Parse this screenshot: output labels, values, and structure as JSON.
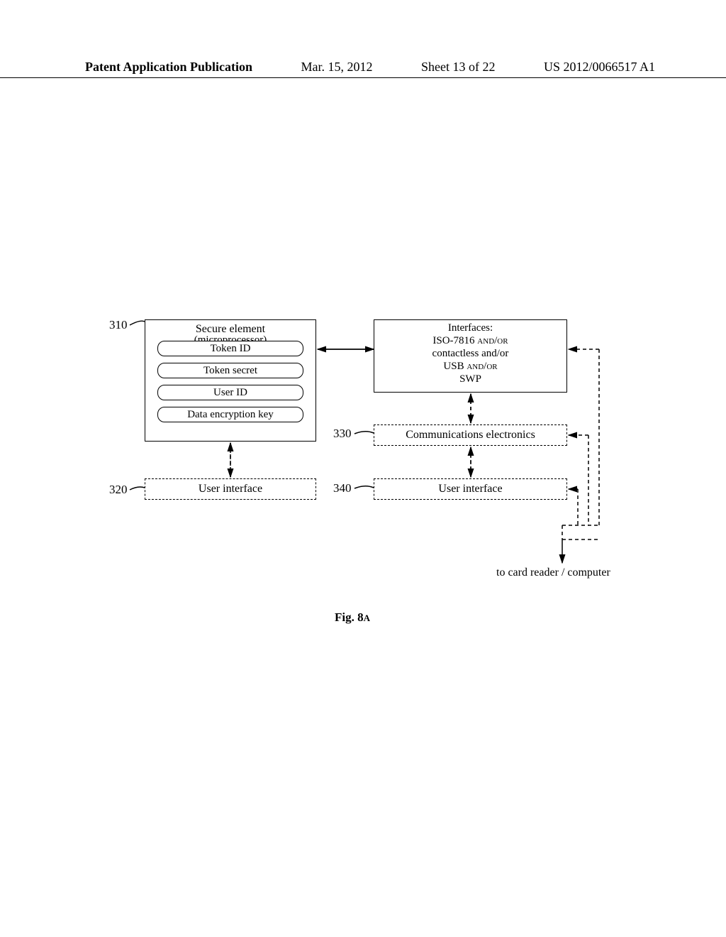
{
  "header": {
    "pub_label": "Patent Application Publication",
    "date": "Mar. 15, 2012",
    "sheet": "Sheet 13 of 22",
    "pub_number": "US 2012/0066517 A1"
  },
  "refs": {
    "r310": "310",
    "r320": "320",
    "r330": "330",
    "r340": "340"
  },
  "secure_element": {
    "title": "Secure element",
    "subtitle": "(microprocessor)",
    "token_id": "Token ID",
    "token_secret": "Token secret",
    "user_id": "User ID",
    "data_key": "Data encryption key"
  },
  "interfaces": {
    "line1": "Interfaces:",
    "line2": "ISO-7816 and/or",
    "line3": "contactless and/or",
    "line4": "USB and/or",
    "line5": "SWP"
  },
  "comm": {
    "label": "Communications electronics"
  },
  "ui_left": {
    "label": "User interface"
  },
  "ui_right": {
    "label": "User interface"
  },
  "out": {
    "label": "to card reader / computer"
  },
  "figure": {
    "caption_prefix": "Fig. 8",
    "caption_suffix": "A"
  }
}
